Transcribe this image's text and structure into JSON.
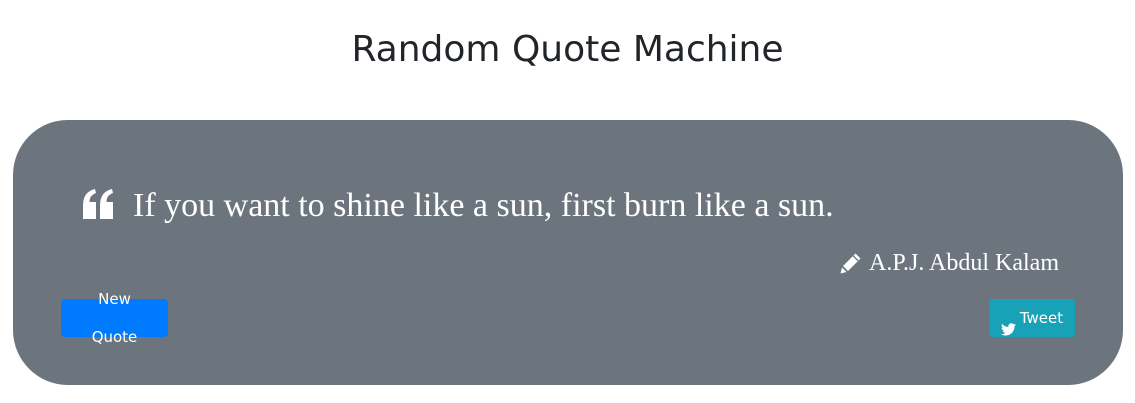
{
  "header": {
    "title": "Random Quote Machine"
  },
  "quote": {
    "icon": "quote-left-icon",
    "text": "If you want to shine like a sun, first burn like a sun.",
    "author_icon": "pencil-icon",
    "author": "A.P.J. Abdul Kalam"
  },
  "actions": {
    "new_quote_label": "New Quote",
    "tweet_icon": "twitter-icon",
    "tweet_label": "Tweet"
  },
  "colors": {
    "card_background": "#6c757d",
    "new_quote_button": "#007bff",
    "tweet_button": "#17a2b8",
    "title_text": "#212529"
  }
}
